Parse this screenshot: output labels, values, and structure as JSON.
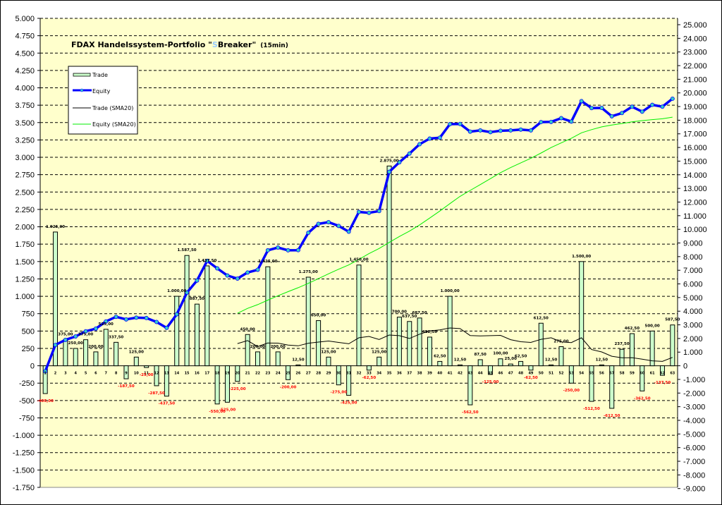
{
  "chart_data": {
    "type": "bar+line",
    "title": {
      "prefix": "FDAX Handelssystem-Portfolio \"",
      "highlight": "S",
      "suffix": "Breaker\"",
      "subtitle": "(15min)",
      "highlight_color": "#99ccff"
    },
    "categories_from": 1,
    "categories_to": 63,
    "left_axis": {
      "min": -1750,
      "max": 5000,
      "step": 250
    },
    "right_axis": {
      "min": -9000,
      "max": 25000,
      "step": 1000
    },
    "grid": "horizontal dashed",
    "legend_position": "top-left",
    "number_format": "de-DE",
    "series": [
      {
        "name": "Trade",
        "type": "bar",
        "axis": "left",
        "color": "#ccffcc",
        "values": [
          -400,
          1925,
          375,
          250,
          375,
          200,
          525,
          337.5,
          -187.5,
          125,
          -25,
          -287.5,
          -437.5,
          1000,
          1587.5,
          887.5,
          1437.5,
          -550,
          -525,
          -225,
          450,
          200,
          1425,
          200,
          -200,
          12.5,
          1275,
          650,
          125,
          -275,
          -425,
          1450,
          -62.5,
          125,
          2875,
          700,
          637.5,
          687.5,
          412.5,
          62.5,
          1000,
          12.5,
          -562.5,
          87.5,
          -125,
          100,
          25,
          62.5,
          -62.5,
          612.5,
          12.5,
          275,
          -250,
          1500,
          -512.5,
          12.5,
          -612.5,
          237.5,
          462.5,
          -362.5,
          500,
          -137.5,
          587.5
        ]
      },
      {
        "name": "Equity",
        "type": "line",
        "axis": "right",
        "color": "#0000ff",
        "cumulative_of": "Trade"
      },
      {
        "name": "Trade (SMA20)",
        "type": "line",
        "axis": "left",
        "color": "#000000",
        "moving_average_of": "Trade",
        "window": 20
      },
      {
        "name": "Equity (SMA20)",
        "type": "line",
        "axis": "right",
        "color": "#00ee00",
        "moving_average_of": "Equity",
        "window": 20
      }
    ],
    "label_colors": {
      "positive": "#000000",
      "negative": "#ff0000"
    },
    "plot_background": "#ffffcc"
  }
}
